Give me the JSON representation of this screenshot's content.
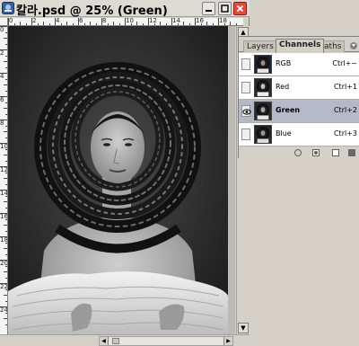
{
  "window": {
    "title": "칼라.psd @ 25% (Green)",
    "buttons": {
      "minimize": "_",
      "maximize": "□",
      "close": "✕"
    },
    "close_color": "#e24a3a"
  },
  "rulers": {
    "horizontal_labels": [
      "0",
      "2",
      "4",
      "6",
      "8",
      "10",
      "12",
      "14",
      "16",
      "18"
    ],
    "vertical_labels": [
      "0",
      "2",
      "4",
      "6",
      "8",
      "10",
      "12",
      "14",
      "16",
      "18",
      "20",
      "22",
      "24"
    ]
  },
  "document": {
    "zoom": "25%",
    "active_channel": "Green",
    "image": "grayscale-portrait-woman-with-coiled-headdress"
  },
  "channels_palette": {
    "tabs": [
      "Layers",
      "Channels",
      "Paths"
    ],
    "active_tab": "Channels",
    "channels": [
      {
        "name": "RGB",
        "shortcut": "Ctrl+~",
        "visible": false,
        "selected": false
      },
      {
        "name": "Red",
        "shortcut": "Ctrl+1",
        "visible": false,
        "selected": false
      },
      {
        "name": "Green",
        "shortcut": "Ctrl+2",
        "visible": true,
        "selected": true
      },
      {
        "name": "Blue",
        "shortcut": "Ctrl+3",
        "visible": false,
        "selected": false
      }
    ],
    "footer_icons": [
      "load-selection-icon",
      "save-selection-icon",
      "new-channel-icon",
      "trash-icon"
    ],
    "selected_color": "#b4b8c8"
  },
  "icons": {
    "eye": "eye-icon",
    "palette_menu": "palette-menu-icon"
  }
}
